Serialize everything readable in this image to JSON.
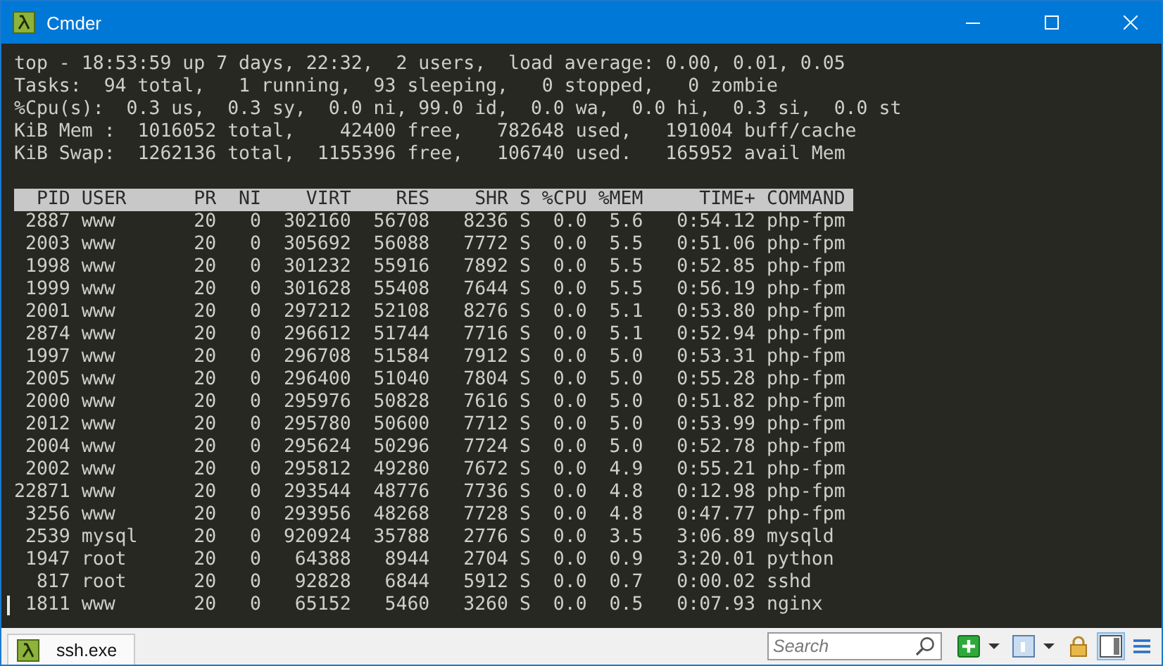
{
  "window": {
    "title": "Cmder"
  },
  "terminal": {
    "summary_lines": [
      "top - 18:53:59 up 7 days, 22:32,  2 users,  load average: 0.00, 0.01, 0.05",
      "Tasks:  94 total,   1 running,  93 sleeping,   0 stopped,   0 zombie",
      "%Cpu(s):  0.3 us,  0.3 sy,  0.0 ni, 99.0 id,  0.0 wa,  0.0 hi,  0.3 si,  0.0 st",
      "KiB Mem :  1016052 total,    42400 free,   782648 used,   191004 buff/cache",
      "KiB Swap:  1262136 total,  1155396 free,   106740 used.   165952 avail Mem"
    ],
    "header": "  PID USER      PR  NI    VIRT    RES    SHR S %CPU %MEM     TIME+ COMMAND",
    "rows": [
      " 2887 www       20   0  302160  56708   8236 S  0.0  5.6   0:54.12 php-fpm",
      " 2003 www       20   0  305692  56088   7772 S  0.0  5.5   0:51.06 php-fpm",
      " 1998 www       20   0  301232  55916   7892 S  0.0  5.5   0:52.85 php-fpm",
      " 1999 www       20   0  301628  55408   7644 S  0.0  5.5   0:56.19 php-fpm",
      " 2001 www       20   0  297212  52108   8276 S  0.0  5.1   0:53.80 php-fpm",
      " 2874 www       20   0  296612  51744   7716 S  0.0  5.1   0:52.94 php-fpm",
      " 1997 www       20   0  296708  51584   7912 S  0.0  5.0   0:53.31 php-fpm",
      " 2005 www       20   0  296400  51040   7804 S  0.0  5.0   0:55.28 php-fpm",
      " 2000 www       20   0  295976  50828   7616 S  0.0  5.0   0:51.82 php-fpm",
      " 2012 www       20   0  295780  50600   7712 S  0.0  5.0   0:53.99 php-fpm",
      " 2004 www       20   0  295624  50296   7724 S  0.0  5.0   0:52.78 php-fpm",
      " 2002 www       20   0  295812  49280   7672 S  0.0  4.9   0:55.21 php-fpm",
      "22871 www       20   0  293544  48776   7736 S  0.0  4.8   0:12.98 php-fpm",
      " 3256 www       20   0  293956  48268   7728 S  0.0  4.8   0:47.77 php-fpm",
      " 2539 mysql     20   0  920924  35788   2776 S  0.0  3.5   3:06.89 mysqld",
      " 1947 root      20   0   64388   8944   2704 S  0.0  0.9   3:20.01 python",
      "  817 root      20   0   92828   6844   5912 S  0.0  0.7   0:00.02 sshd",
      " 1811 www       20   0   65152   5460   3260 S  0.0  0.5   0:07.93 nginx"
    ]
  },
  "tabs": [
    {
      "label": "ssh.exe",
      "selected": true
    }
  ],
  "search": {
    "placeholder": "Search"
  }
}
